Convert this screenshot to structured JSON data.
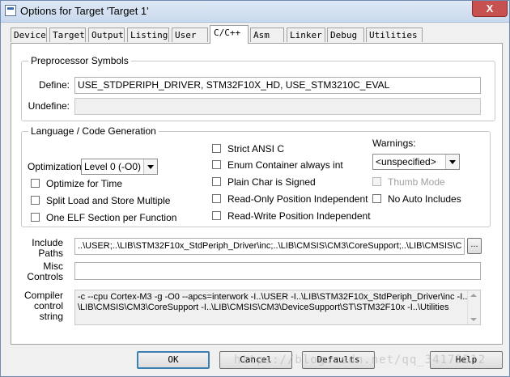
{
  "window": {
    "title": "Options for Target 'Target 1'",
    "close_label": "X"
  },
  "colors": {
    "title_bar": "#c9d9ee",
    "close_button": "#c75050",
    "default_button_border": "#3c7fb1"
  },
  "tabs": [
    {
      "label": "Device",
      "active": false
    },
    {
      "label": "Target",
      "active": false
    },
    {
      "label": "Output",
      "active": false
    },
    {
      "label": "Listing",
      "active": false
    },
    {
      "label": "User",
      "active": false
    },
    {
      "label": "C/C++",
      "active": true
    },
    {
      "label": "Asm",
      "active": false
    },
    {
      "label": "Linker",
      "active": false
    },
    {
      "label": "Debug",
      "active": false
    },
    {
      "label": "Utilities",
      "active": false
    }
  ],
  "preprocessor": {
    "legend": "Preprocessor Symbols",
    "define_label": "Define:",
    "define_value": "USE_STDPERIPH_DRIVER, STM32F10X_HD, USE_STM3210C_EVAL",
    "undefine_label": "Undefine:",
    "undefine_value": ""
  },
  "language": {
    "legend": "Language / Code Generation",
    "optimization_label": "Optimization:",
    "optimization_value": "Level 0 (-O0)",
    "optimize_for_time": "Optimize for Time",
    "split_load_store": "Split Load and Store Multiple",
    "one_elf_section": "One ELF Section per Function",
    "strict_ansi": "Strict ANSI C",
    "enum_container": "Enum Container always int",
    "plain_char_signed": "Plain Char is Signed",
    "ro_position_independent": "Read-Only Position Independent",
    "rw_position_independent": "Read-Write Position Independent",
    "warnings_label": "Warnings:",
    "warnings_value": "<unspecified>",
    "thumb_mode": "Thumb Mode",
    "no_auto_includes": "No Auto Includes"
  },
  "include_paths": {
    "label_line1": "Include",
    "label_line2": "Paths",
    "value": "..\\USER;..\\LIB\\STM32F10x_StdPeriph_Driver\\inc;..\\LIB\\CMSIS\\CM3\\CoreSupport;..\\LIB\\CMSIS\\C",
    "browse_label": "..."
  },
  "misc_controls": {
    "label_line1": "Misc",
    "label_line2": "Controls",
    "value": ""
  },
  "compiler_control": {
    "label_line1": "Compiler",
    "label_line2": "control",
    "label_line3": "string",
    "line1": "-c --cpu Cortex-M3 -g -O0 --apcs=interwork -I..\\USER -I..\\LIB\\STM32F10x_StdPeriph_Driver\\inc -I..",
    "line2": "\\LIB\\CMSIS\\CM3\\CoreSupport -I..\\LIB\\CMSIS\\CM3\\DeviceSupport\\ST\\STM32F10x -I..\\Utilities"
  },
  "buttons": {
    "ok": "OK",
    "cancel": "Cancel",
    "defaults": "Defaults",
    "help": "Help"
  },
  "watermark": "https://blog.csdn.net/qq_34175512"
}
